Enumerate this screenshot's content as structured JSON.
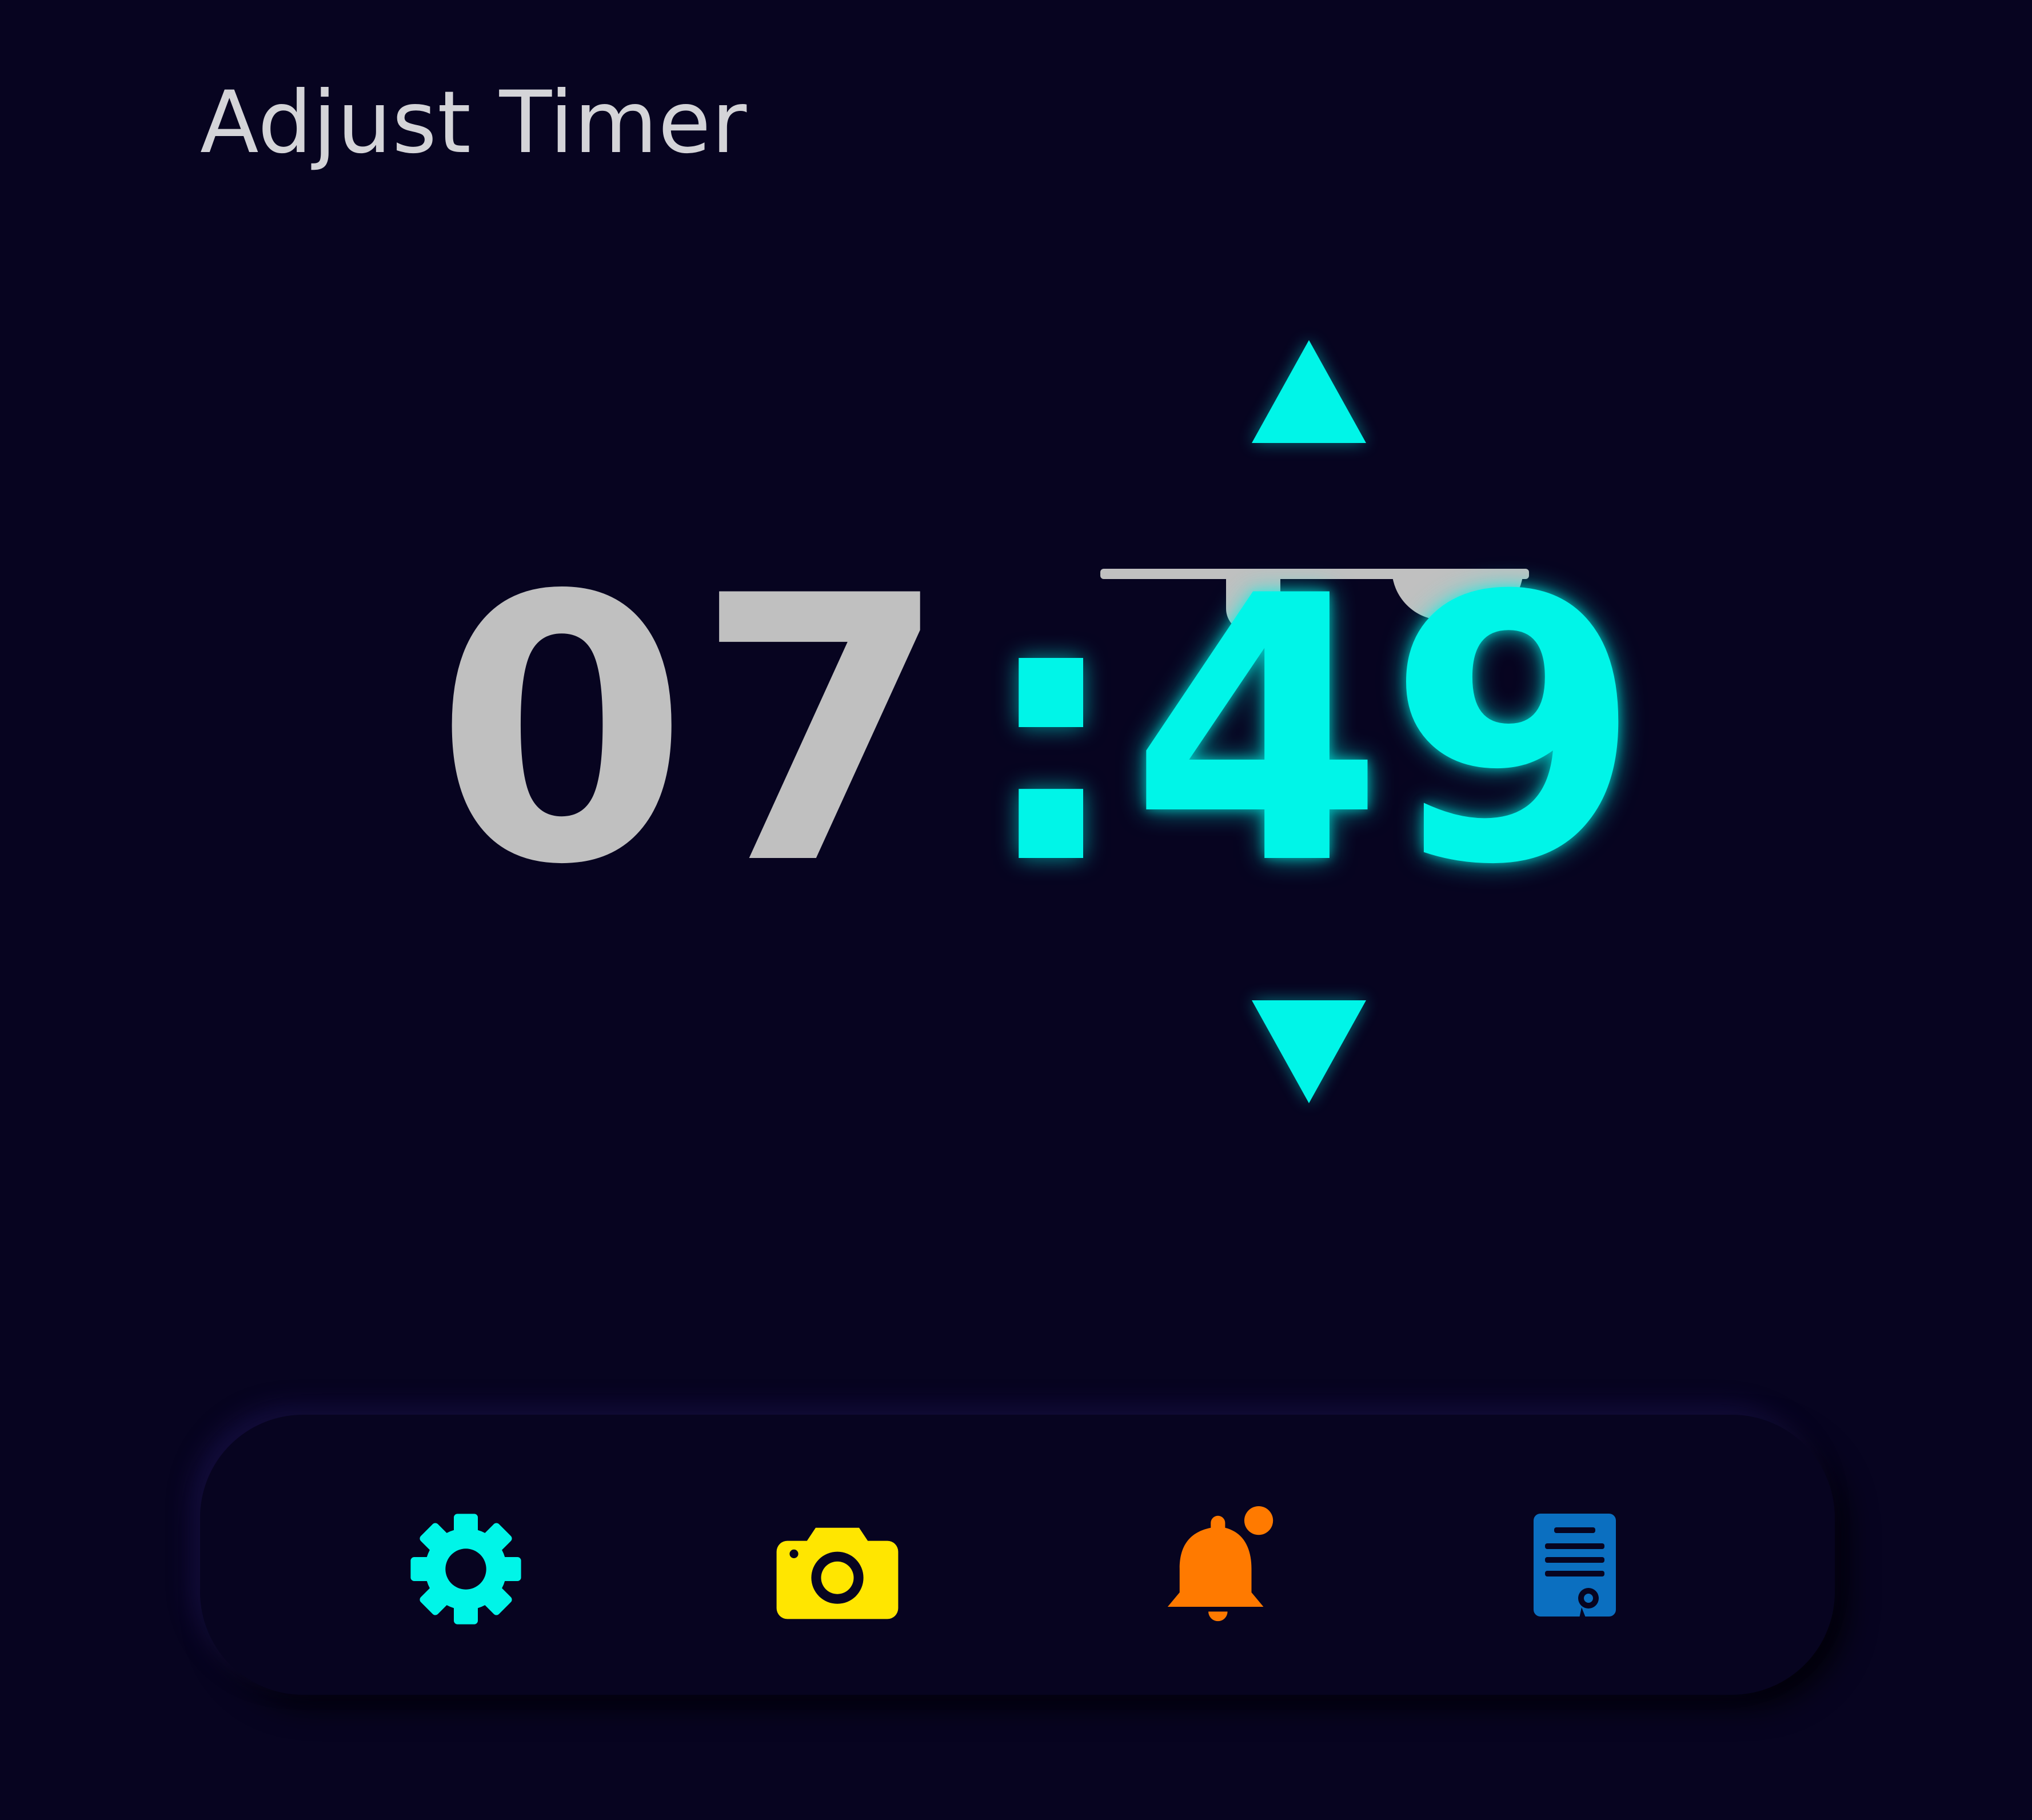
{
  "header": {
    "title": "Adjust Timer"
  },
  "timer": {
    "hours": "07",
    "separator": ":",
    "minutes": "49",
    "accent_color": "#00f5e8",
    "inactive_color": "#c0c0c0"
  },
  "controls": {
    "increment_icon": "triangle-up-icon",
    "decrement_icon": "triangle-down-icon"
  },
  "dock": {
    "items": [
      {
        "icon": "gear-icon",
        "color": "#00f5e8"
      },
      {
        "icon": "camera-icon",
        "color": "#ffe600"
      },
      {
        "icon": "bell-icon",
        "color": "#ff7a00"
      },
      {
        "icon": "document-certificate-icon",
        "color": "#0b6fc0"
      }
    ]
  },
  "theme": {
    "background": "#070420"
  }
}
